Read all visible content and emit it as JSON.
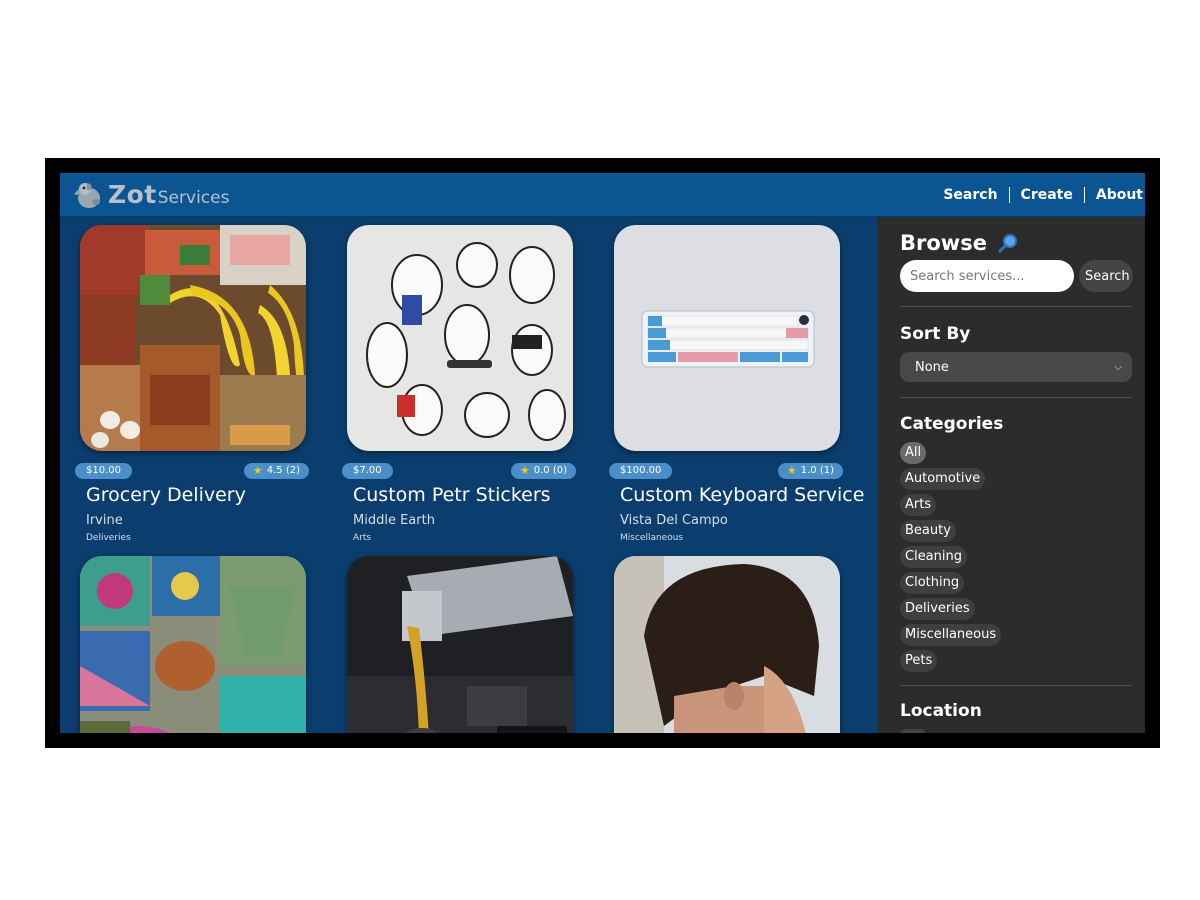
{
  "header": {
    "logo_main": "Zot",
    "logo_sub": "Services",
    "nav": [
      "Search",
      "Create",
      "About"
    ]
  },
  "listings": [
    {
      "price": "$10.00",
      "rating": "4.5 (2)",
      "title": "Grocery Delivery",
      "location": "Irvine",
      "category": "Deliveries",
      "image": "groceries-photo"
    },
    {
      "price": "$7.00",
      "rating": "0.0 (0)",
      "title": "Custom Petr Stickers",
      "location": "Middle Earth",
      "category": "Arts",
      "image": "stickers-photo"
    },
    {
      "price": "$100.00",
      "rating": "1.0 (1)",
      "title": "Custom Keyboard Service",
      "location": "Vista Del Campo",
      "category": "Miscellaneous",
      "image": "keyboard-photo"
    },
    {
      "image": "crochet-photo"
    },
    {
      "image": "motor-oil-photo"
    },
    {
      "image": "haircut-photo"
    }
  ],
  "sidebar": {
    "browse_title": "Browse",
    "browse_icon": "magnifier-icon",
    "search_placeholder": "Search services...",
    "search_button": "Search",
    "sort_title": "Sort By",
    "sort_value": "None",
    "categories_title": "Categories",
    "categories": [
      "All",
      "Automotive",
      "Arts",
      "Beauty",
      "Cleaning",
      "Clothing",
      "Deliveries",
      "Miscellaneous",
      "Pets"
    ],
    "active_category": "All",
    "location_title": "Location"
  },
  "colors": {
    "header_bg": "#0a5592",
    "main_bg": "#0b3e6e",
    "sidebar_bg": "#2c2c2c",
    "badge_bg": "#4a8fc8",
    "star": "#f5c518"
  }
}
